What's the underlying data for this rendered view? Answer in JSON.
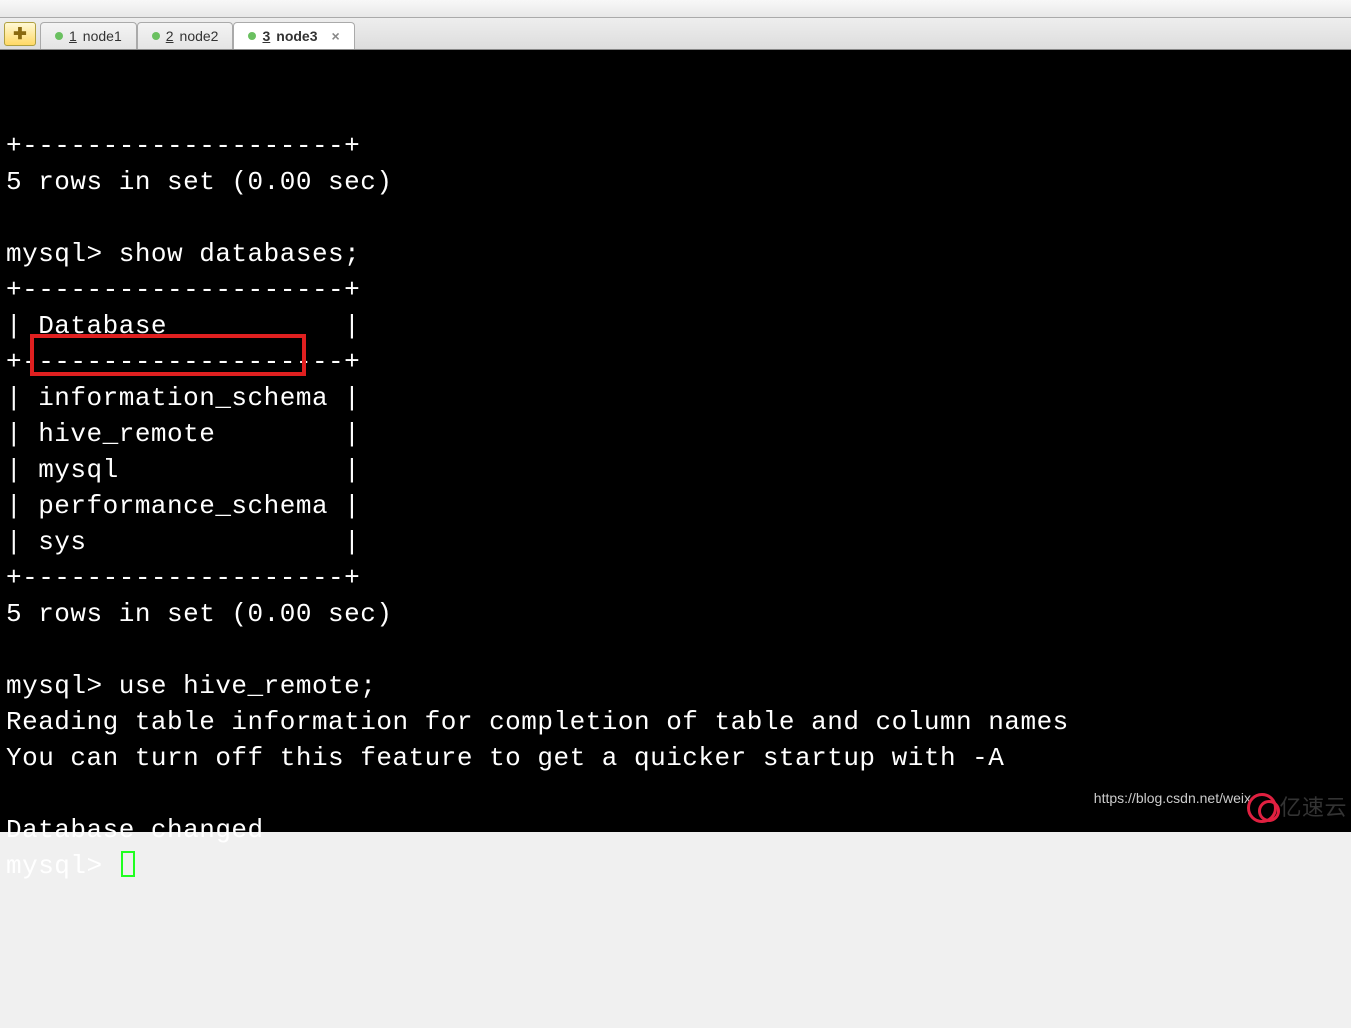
{
  "tabs": [
    {
      "num": "1",
      "label": "node1",
      "active": false,
      "closable": false
    },
    {
      "num": "2",
      "label": "node2",
      "active": false,
      "closable": false
    },
    {
      "num": "3",
      "label": "node3",
      "active": true,
      "closable": true
    }
  ],
  "new_tab_glyph": "✚",
  "terminal": {
    "lines": [
      "+--------------------+",
      "5 rows in set (0.00 sec)",
      "",
      "mysql> show databases;",
      "+--------------------+",
      "| Database           |",
      "+--------------------+",
      "| information_schema |",
      "| hive_remote        |",
      "| mysql              |",
      "| performance_schema |",
      "| sys                |",
      "+--------------------+",
      "5 rows in set (0.00 sec)",
      "",
      "mysql> use hive_remote;",
      "Reading table information for completion of table and column names",
      "You can turn off this feature to get a quicker startup with -A",
      "",
      "Database changed",
      "mysql> "
    ],
    "highlighted_text": "hive_remote",
    "prompt": "mysql>"
  },
  "watermark": {
    "url": "https://blog.csdn.net/weix",
    "logo_text": "亿速云"
  }
}
